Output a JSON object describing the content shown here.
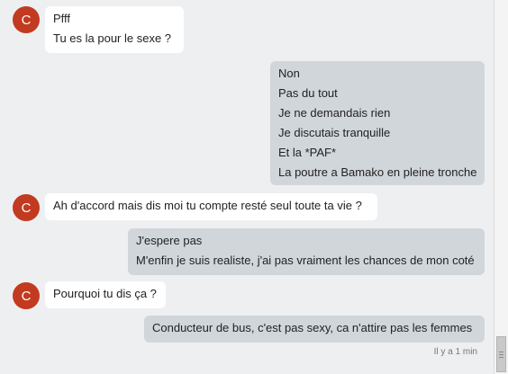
{
  "messages": [
    {
      "sender": "other",
      "avatar": "C",
      "lines": [
        "Pfff",
        "Tu es la pour le sexe ?"
      ]
    },
    {
      "sender": "me",
      "lines": [
        "Non",
        "Pas du tout",
        "Je ne demandais rien",
        "Je discutais tranquille",
        "Et la *PAF*",
        "La poutre a Bamako en pleine tronche"
      ]
    },
    {
      "sender": "other",
      "avatar": "C",
      "lines": [
        "Ah d'accord mais dis moi tu compte resté seul toute ta vie ?"
      ]
    },
    {
      "sender": "me",
      "lines": [
        "J'espere pas",
        "M'enfin je suis realiste, j'ai pas vraiment les chances de mon coté"
      ]
    },
    {
      "sender": "other",
      "avatar": "C",
      "lines": [
        "Pourquoi tu dis ça ?"
      ]
    },
    {
      "sender": "me",
      "lines": [
        "Conducteur de bus, c'est pas sexy, ca n'attire pas les femmes"
      ]
    }
  ],
  "timestamp": "Il y a 1 min",
  "colors": {
    "avatar": "#c23a1f",
    "incoming_bubble": "#ffffff",
    "outgoing_bubble": "#d1d6db",
    "background": "#eeeff1"
  }
}
